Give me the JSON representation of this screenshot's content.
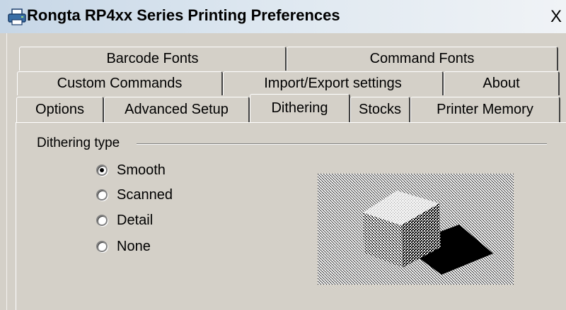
{
  "window": {
    "title": "Rongta RP4xx Series Printing Preferences",
    "close_glyph": "X",
    "icon": "printer-icon"
  },
  "tabs": {
    "row1": [
      "Barcode Fonts",
      "Command Fonts"
    ],
    "row2": [
      "Custom Commands",
      "Import/Export settings",
      "About"
    ],
    "row3": [
      "Options",
      "Advanced Setup",
      "Dithering",
      "Stocks",
      "Printer Memory"
    ],
    "active": "Dithering"
  },
  "dithering": {
    "group_label": "Dithering type",
    "options": [
      "Smooth",
      "Scanned",
      "Detail",
      "None"
    ],
    "selected": "Smooth"
  },
  "preview": {
    "icon": "dithered-cube-preview"
  }
}
